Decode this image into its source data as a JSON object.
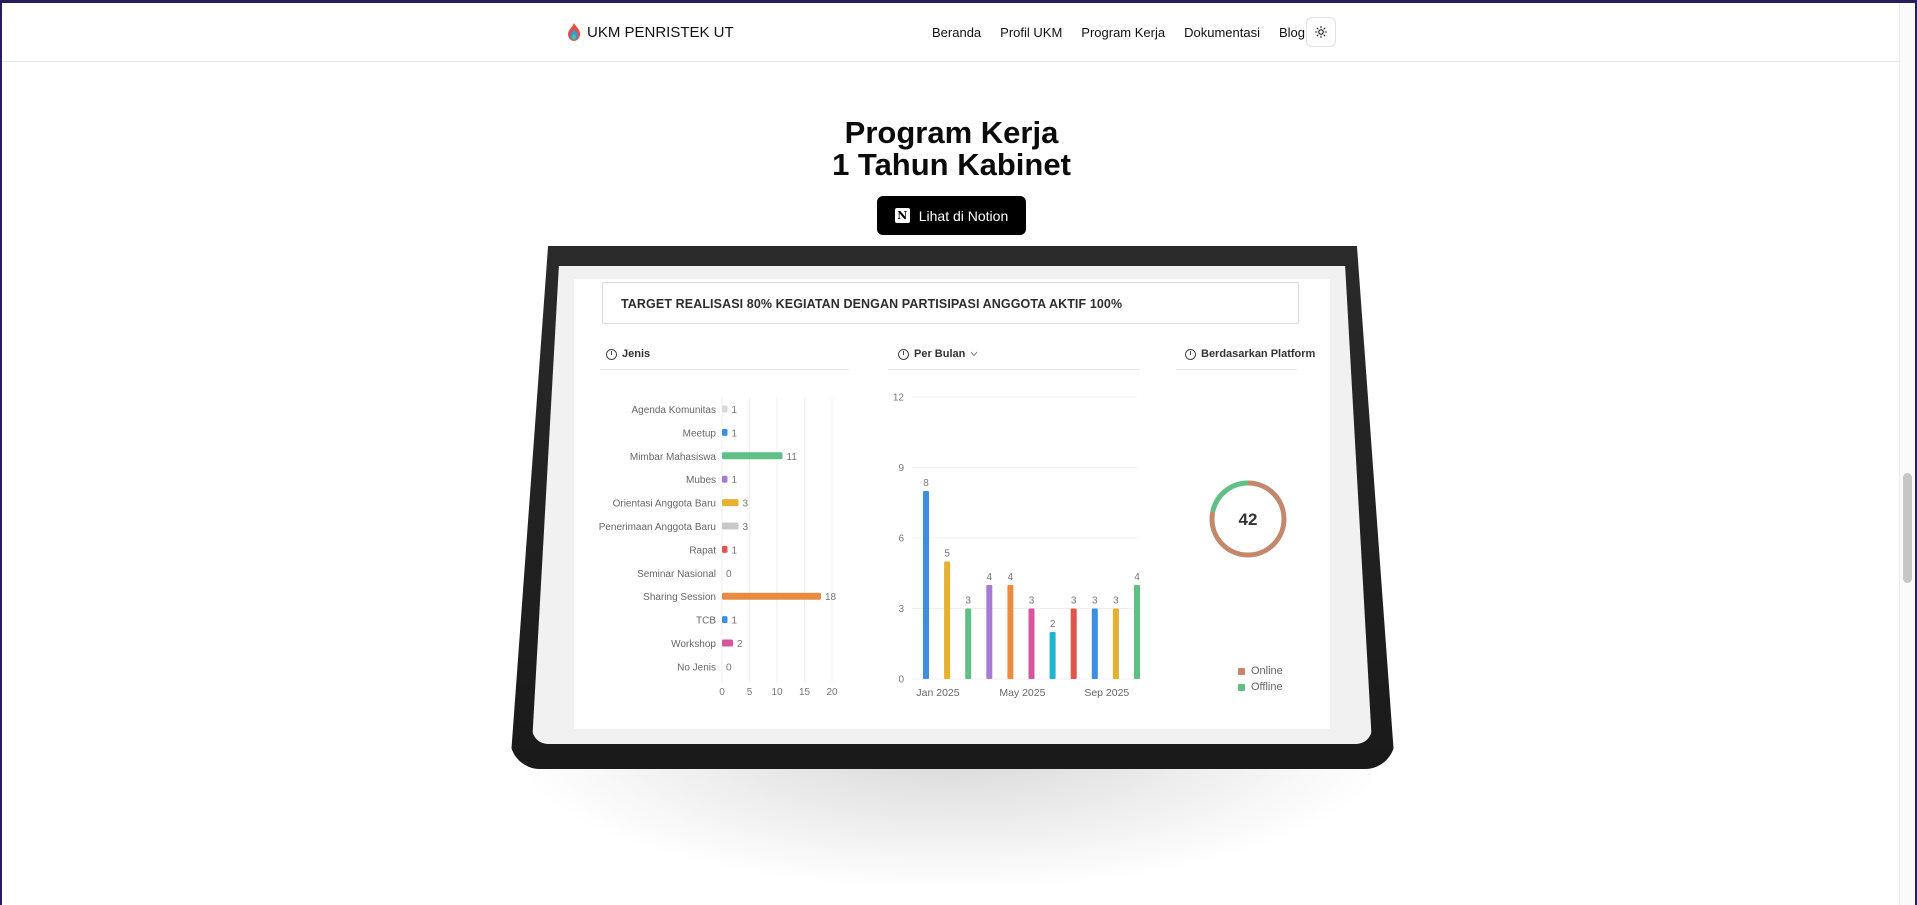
{
  "nav": {
    "brand": "UKM PENRISTEK UT",
    "links": [
      "Beranda",
      "Profil UKM",
      "Program Kerja",
      "Dokumentasi",
      "Blog"
    ]
  },
  "hero": {
    "title_line1": "Program Kerja",
    "title_line2": "1 Tahun Kabinet",
    "cta_label": "Lihat di Notion"
  },
  "dashboard": {
    "target_text": "TARGET REALISASI 80% KEGIATAN DENGAN PARTISIPASI ANGGOTA AKTIF 100%",
    "panel_jenis": "Jenis",
    "panel_bulan": "Per Bulan",
    "panel_platform": "Berdasarkan Platform",
    "donut_total": "42",
    "legend": [
      {
        "label": "Online",
        "color": "#c4876a"
      },
      {
        "label": "Offline",
        "color": "#5fbf85"
      }
    ]
  },
  "chart_data": [
    {
      "type": "bar",
      "orientation": "horizontal",
      "title": "Jenis",
      "categories": [
        "Agenda Komunitas",
        "Meetup",
        "Mimbar Mahasiswa",
        "Mubes",
        "Orientasi Anggota Baru",
        "Penerimaan Anggota Baru",
        "Rapat",
        "Seminar Nasional",
        "Sharing Session",
        "TCB",
        "Workshop",
        "No Jenis"
      ],
      "values": [
        1,
        1,
        11,
        1,
        3,
        3,
        1,
        0,
        18,
        1,
        2,
        0
      ],
      "colors": [
        "#d8d8d8",
        "#3a8fe0",
        "#5fbf85",
        "#a77ad6",
        "#e6b030",
        "#c8c8c8",
        "#e0544e",
        "#cccccc",
        "#e88c44",
        "#3a8fe0",
        "#d6559e",
        "#cccccc"
      ],
      "xticks": [
        0,
        5,
        10,
        15,
        20
      ],
      "xlim": [
        0,
        20
      ]
    },
    {
      "type": "bar",
      "title": "Per Bulan",
      "xtick_labels": [
        "Jan 2025",
        "May 2025",
        "Sep 2025"
      ],
      "values": [
        8,
        5,
        3,
        4,
        4,
        3,
        2,
        3,
        3,
        3,
        4
      ],
      "colors": [
        "#3a8fe0",
        "#e6b030",
        "#5fbf85",
        "#a77ad6",
        "#e88c44",
        "#d6559e",
        "#20b5cf",
        "#e0544e",
        "#3a8fe0",
        "#e6b030",
        "#5fbf85"
      ],
      "yticks": [
        0,
        3,
        6,
        9,
        12
      ],
      "ylim": [
        0,
        12
      ]
    },
    {
      "type": "pie",
      "title": "Berdasarkan Platform",
      "total": 42,
      "categories": [
        "Online",
        "Offline"
      ],
      "values": [
        0.78,
        0.22
      ]
    }
  ]
}
